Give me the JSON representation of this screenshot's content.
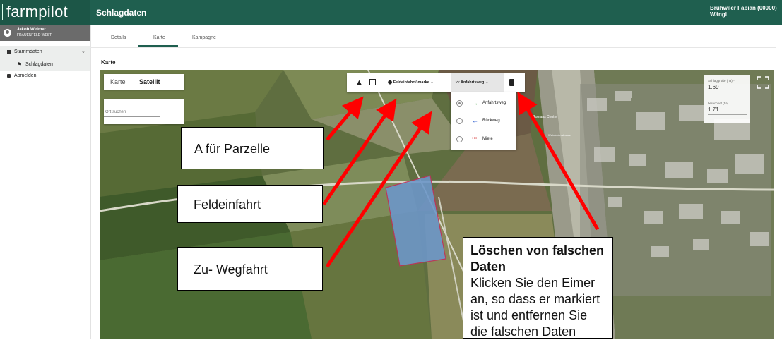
{
  "header": {
    "logo": "farmpilot",
    "title": "Schlagdaten",
    "user_name": "Brühwiler Fabian (00000)",
    "user_location": "Wängi"
  },
  "sidebar": {
    "user": {
      "name": "Jakob Widmer",
      "sub": "FRAUENFELD WEST"
    },
    "items": [
      {
        "label": "Stammdaten"
      },
      {
        "label": "Schlagdaten"
      },
      {
        "label": "Abmelden"
      }
    ]
  },
  "tabs": [
    {
      "label": "Details"
    },
    {
      "label": "Karte"
    },
    {
      "label": "Kampagne"
    }
  ],
  "section_label": "Karte",
  "map": {
    "type_toggle": {
      "map": "Karte",
      "satellite": "Satellit"
    },
    "search_placeholder": "Ort suchen",
    "toolbar": {
      "field_entry": "Feldeinfahrt/-marke",
      "route": "Anfahrtsweg"
    },
    "route_options": [
      {
        "label": "Anfahrtsweg",
        "selected": true,
        "arrow": "→",
        "color": "#3a9a3a"
      },
      {
        "label": "Rückweg",
        "selected": false,
        "arrow": "←",
        "color": "#2255cc"
      },
      {
        "label": "Miete",
        "selected": false,
        "arrow": "•••",
        "color": "#d02020"
      }
    ],
    "stats": {
      "area_label": "Schlaggröße (ha) *",
      "area_value": "1.69",
      "calc_label": "berechnet (ha)",
      "calc_value": "1.71"
    },
    "labels": [
      "Romans Center",
      "Weinfelderstrasse"
    ]
  },
  "callouts": {
    "parzelle": "A für Parzelle",
    "feldeinfahrt": "Feldeinfahrt",
    "wegfahrt": "Zu- Wegfahrt",
    "delete_title": "Löschen von falschen Daten",
    "delete_text": "Klicken Sie den Eimer an, so dass er markiert ist und entfernen Sie die falschen Daten"
  },
  "colors": {
    "header": "#1f5f4f",
    "arrow": "#ff0000",
    "field": "#5b86b8"
  }
}
